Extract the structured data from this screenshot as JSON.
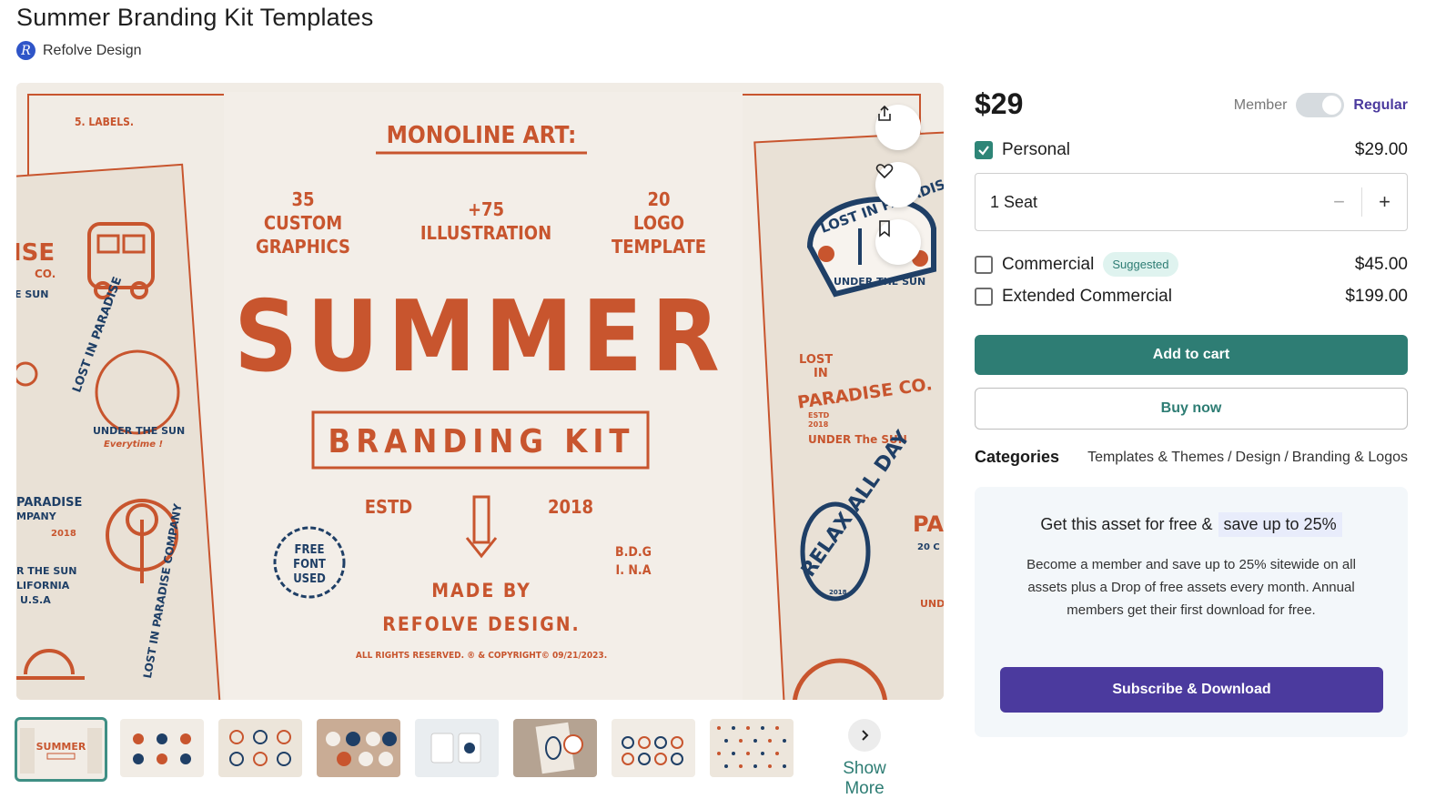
{
  "page": {
    "title": "Summer Branding Kit Templates",
    "author_initial": "R",
    "author": "Refolve Design"
  },
  "preview": {
    "labels_tag": "5. LABELS.",
    "monoline": "MONOLINE ART:",
    "stat1": [
      "35",
      "CUSTOM",
      "GRAPHICS"
    ],
    "stat2": [
      "+75",
      "ILLUSTRATION"
    ],
    "stat3": [
      "20",
      "LOGO",
      "TEMPLATE"
    ],
    "headline": "SUMMER",
    "subheadline": "BRANDING KIT",
    "estd": "ESTD",
    "year": "2018",
    "made_by": "MADE BY",
    "maker": "REFOLVE DESIGN.",
    "initials": [
      "B.D.G",
      "I. N.A"
    ],
    "stamp": [
      "FREE",
      "FONT",
      "USED"
    ],
    "rights": "ALL RIGHTS RESERVED. ® & COPYRIGHT© 09/21/2023.",
    "left_card": [
      "ISE",
      "CO.",
      "E SUN",
      "LOST IN PARADISE",
      "UNDER THE SUN",
      "Everytime !",
      "PARADISE",
      "MPANY",
      "R THE SUN",
      "LIFORNIA",
      "U.S.A",
      "2018",
      "LOST IN PARADISE COMPANY"
    ],
    "right_card": [
      "LOST IN PARADISE",
      "UNDER THE SUN",
      "20",
      "18",
      "LOST",
      "IN",
      "PARADISE CO.",
      "ESTD",
      "2018",
      "UNDER The SUN",
      "RELAX ALL DAY",
      "2018",
      "PA",
      "20 C",
      "UND"
    ]
  },
  "actions": {
    "share_icon": "share-icon",
    "like_icon": "heart-icon",
    "save_icon": "bookmark-icon"
  },
  "thumbnails": {
    "count": 8,
    "first_caption": "SUMMER",
    "show_more": "Show More"
  },
  "pricing": {
    "price": "$29",
    "member_label": "Member",
    "regular_label": "Regular",
    "licenses": [
      {
        "name": "Personal",
        "price": "$29.00",
        "checked": true
      },
      {
        "name": "Commercial",
        "price": "$45.00",
        "checked": false,
        "badge": "Suggested"
      },
      {
        "name": "Extended Commercial",
        "price": "$199.00",
        "checked": false
      }
    ],
    "seats": "1 Seat",
    "minus": "−",
    "plus": "+",
    "add_to_cart": "Add to cart",
    "buy_now": "Buy now"
  },
  "categories": {
    "label": "Categories",
    "path": [
      "Templates & Themes",
      "/",
      "Design",
      "/",
      "Branding & Logos"
    ]
  },
  "promo": {
    "heading_a": "Get this asset for free &",
    "heading_b": "save up to 25%",
    "body": "Become a member and save up to 25% sitewide on all assets plus a Drop of free assets every month. Annual members get their first download for free.",
    "cta": "Subscribe & Download"
  },
  "colors": {
    "accent": "#2e7d74",
    "brand_purple": "#4b3a9e",
    "art_orange": "#c8552e",
    "art_navy": "#1f3f66",
    "paper": "#efe9e1"
  }
}
